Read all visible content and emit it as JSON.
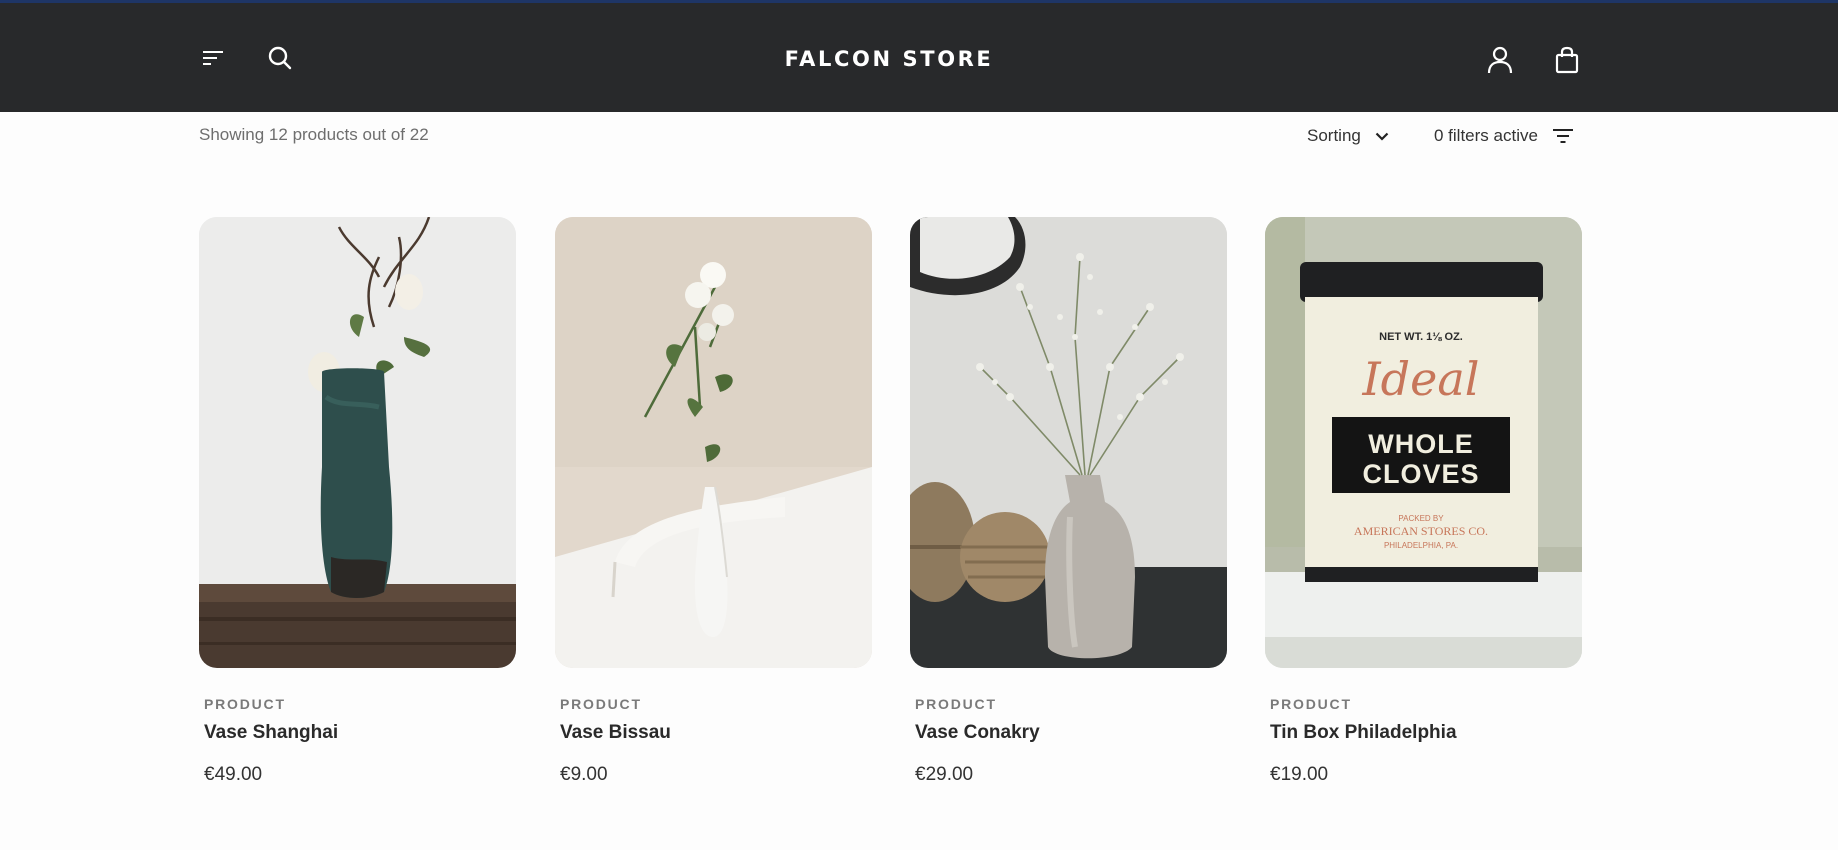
{
  "header": {
    "logo": "FALCON STORE",
    "menu_icon": "menu-icon",
    "search_icon": "search-icon",
    "account_icon": "user-icon",
    "cart_icon": "shopping-bag-icon",
    "background": "#28292b",
    "accent_line": "#1e3566"
  },
  "toolbar": {
    "result_count": "Showing 12 products out of 22",
    "sorting_label": "Sorting",
    "filters_label": "0 filters active"
  },
  "products": [
    {
      "type": "PRODUCT",
      "name": "Vase Shanghai",
      "price": "€49.00"
    },
    {
      "type": "PRODUCT",
      "name": "Vase Bissau",
      "price": "€9.00"
    },
    {
      "type": "PRODUCT",
      "name": "Vase Conakry",
      "price": "€29.00"
    },
    {
      "type": "PRODUCT",
      "name": "Tin Box Philadelphia",
      "price": "€19.00",
      "image_text": {
        "weight": "NET WT. 1⅛ OZ.",
        "brand": "Ideal",
        "line1": "WHOLE",
        "line2": "CLOVES",
        "packed": "PACKED BY",
        "company": "AMERICAN STORES CO.",
        "city": "PHILADELPHIA, PA."
      }
    }
  ]
}
